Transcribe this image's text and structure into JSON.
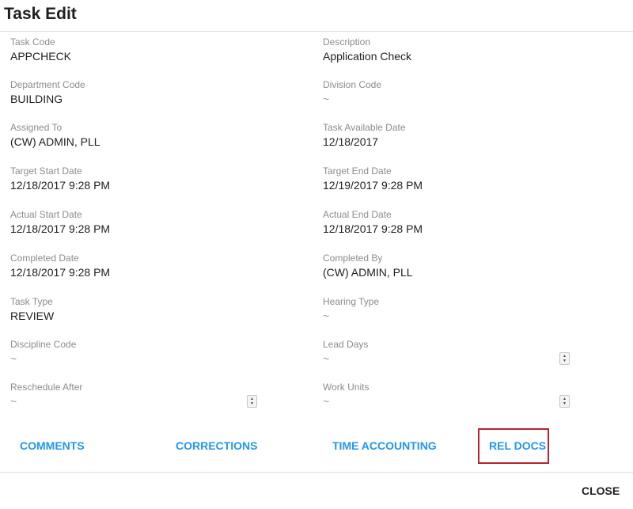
{
  "header": {
    "title": "Task Edit"
  },
  "fields": {
    "task_code": {
      "label": "Task Code",
      "value": "APPCHECK"
    },
    "description": {
      "label": "Description",
      "value": "Application Check"
    },
    "department_code": {
      "label": "Department Code",
      "value": "BUILDING"
    },
    "division_code": {
      "label": "Division Code",
      "value": "~"
    },
    "assigned_to": {
      "label": "Assigned To",
      "value": "(CW) ADMIN, PLL"
    },
    "task_available_date": {
      "label": "Task Available Date",
      "value": "12/18/2017"
    },
    "target_start_date": {
      "label": "Target Start Date",
      "value": "12/18/2017 9:28 PM"
    },
    "target_end_date": {
      "label": "Target End Date",
      "value": "12/19/2017 9:28 PM"
    },
    "actual_start_date": {
      "label": "Actual Start Date",
      "value": "12/18/2017 9:28 PM"
    },
    "actual_end_date": {
      "label": "Actual End Date",
      "value": "12/18/2017 9:28 PM"
    },
    "completed_date": {
      "label": "Completed Date",
      "value": "12/18/2017 9:28 PM"
    },
    "completed_by": {
      "label": "Completed By",
      "value": "(CW) ADMIN, PLL"
    },
    "task_type": {
      "label": "Task Type",
      "value": "REVIEW"
    },
    "hearing_type": {
      "label": "Hearing Type",
      "value": "~"
    },
    "discipline_code": {
      "label": "Discipline Code",
      "value": "~"
    },
    "lead_days": {
      "label": "Lead Days",
      "value": "~"
    },
    "reschedule_after": {
      "label": "Reschedule After",
      "value": "~"
    },
    "work_units": {
      "label": "Work Units",
      "value": "~"
    }
  },
  "actions": {
    "comments": "COMMENTS",
    "corrections": "CORRECTIONS",
    "time_accounting": "TIME ACCOUNTING",
    "rel_docs": "REL DOCS",
    "highlight_color": "#b8232f",
    "link_color": "#2196f3"
  },
  "footer": {
    "close": "CLOSE"
  }
}
